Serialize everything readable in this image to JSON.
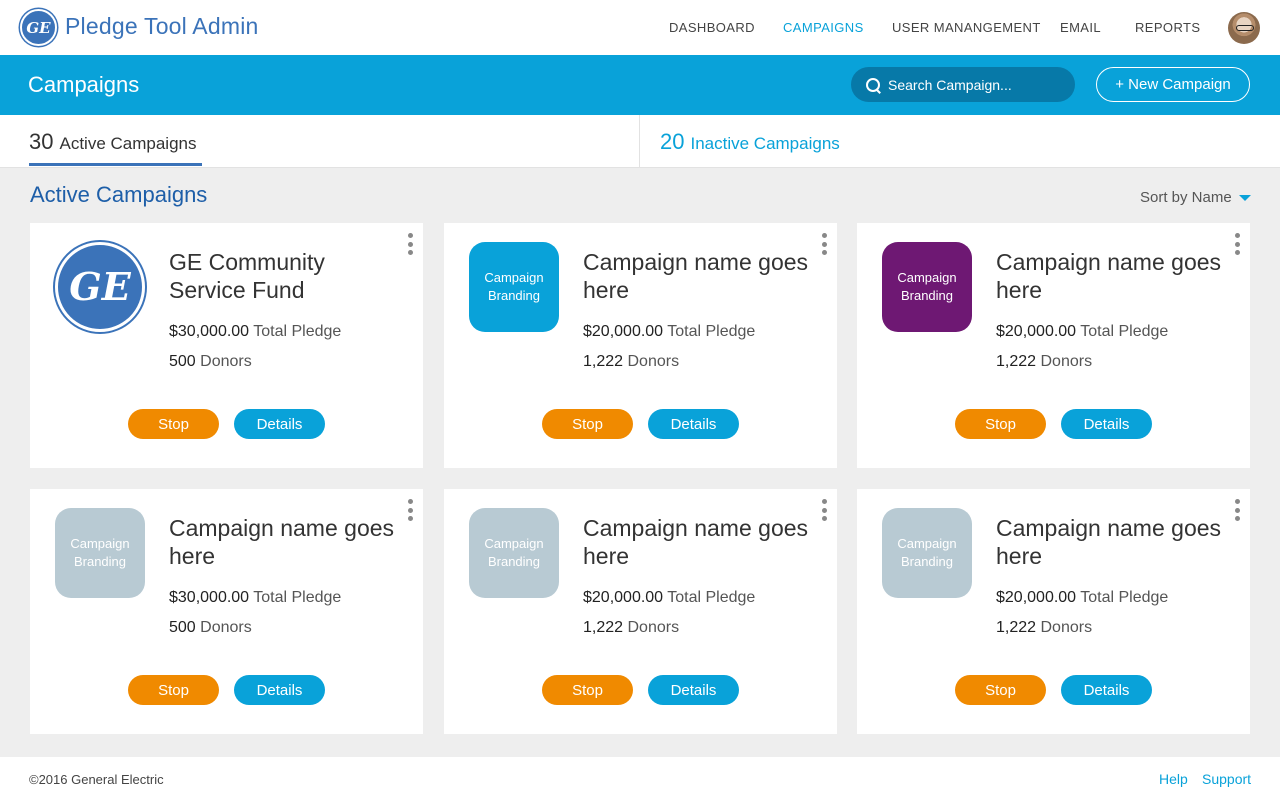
{
  "app": {
    "logo_text": "GE",
    "title": "Pledge Tool Admin"
  },
  "nav": {
    "items": [
      "DASHBOARD",
      "CAMPAIGNS",
      "USER MANANGEMENT",
      "EMAIL",
      "REPORTS"
    ],
    "active": "CAMPAIGNS"
  },
  "header": {
    "title": "Campaigns",
    "search_placeholder": "Search Campaign...",
    "new_button": "+ New Campaign",
    "bar_color": "#09a2d9"
  },
  "tabs": {
    "active": {
      "count": "30",
      "label": "Active Campaigns"
    },
    "inactive": {
      "count": "20",
      "label": "Inactive Campaigns"
    }
  },
  "section": {
    "title": "Active Campaigns",
    "sort_label": "Sort by Name"
  },
  "cards": [
    {
      "brand_type": "ge-logo",
      "brand_text": "GE",
      "brand_color": "#3b73b9",
      "name": "GE Community Service Fund",
      "pledge_value": "$30,000.00",
      "pledge_label": "Total Pledge",
      "donors_value": "500",
      "donors_label": "Donors",
      "stop": "Stop",
      "details": "Details"
    },
    {
      "brand_type": "tile",
      "brand_text": "Campaign Branding",
      "brand_color": "#09a2d9",
      "name": "Campaign name goes here",
      "pledge_value": "$20,000.00",
      "pledge_label": "Total Pledge",
      "donors_value": "1,222",
      "donors_label": "Donors",
      "stop": "Stop",
      "details": "Details"
    },
    {
      "brand_type": "tile",
      "brand_text": "Campaign Branding",
      "brand_color": "#6e1873",
      "name": "Campaign name goes here",
      "pledge_value": "$20,000.00",
      "pledge_label": "Total Pledge",
      "donors_value": "1,222",
      "donors_label": "Donors",
      "stop": "Stop",
      "details": "Details"
    },
    {
      "brand_type": "tile",
      "brand_text": "Campaign Branding",
      "brand_color": "#b8cad3",
      "name": "Campaign name goes here",
      "pledge_value": "$30,000.00",
      "pledge_label": "Total Pledge",
      "donors_value": "500",
      "donors_label": "Donors",
      "stop": "Stop",
      "details": "Details"
    },
    {
      "brand_type": "tile",
      "brand_text": "Campaign Branding",
      "brand_color": "#b8cad3",
      "name": "Campaign name goes here",
      "pledge_value": "$20,000.00",
      "pledge_label": "Total Pledge",
      "donors_value": "1,222",
      "donors_label": "Donors",
      "stop": "Stop",
      "details": "Details"
    },
    {
      "brand_type": "tile",
      "brand_text": "Campaign Branding",
      "brand_color": "#b8cad3",
      "name": "Campaign name goes here",
      "pledge_value": "$20,000.00",
      "pledge_label": "Total Pledge",
      "donors_value": "1,222",
      "donors_label": "Donors",
      "stop": "Stop",
      "details": "Details"
    }
  ],
  "footer": {
    "copyright": "©2016 General Electric",
    "help": "Help",
    "support": "Support"
  },
  "colors": {
    "accent": "#09a2d9",
    "brand_blue": "#3b73b9",
    "stop_orange": "#f08a00"
  }
}
